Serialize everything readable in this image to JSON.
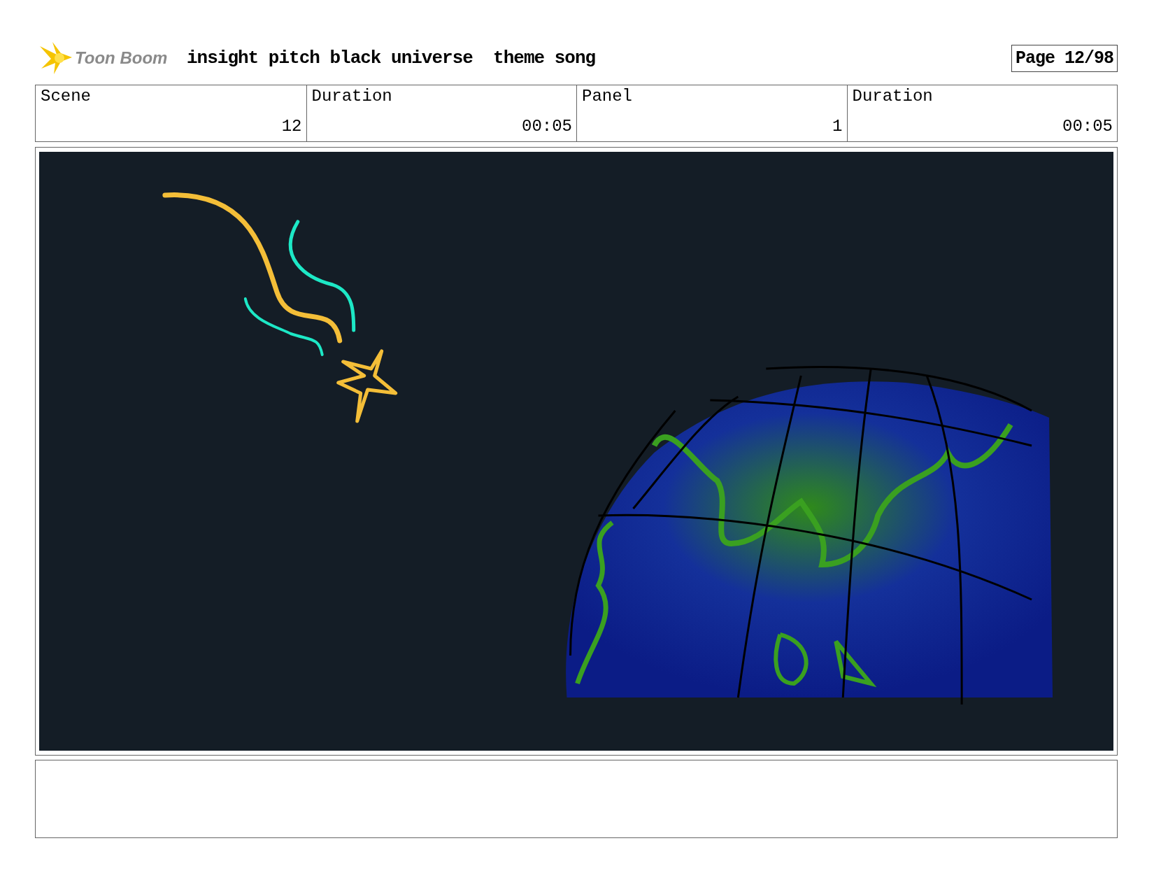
{
  "header": {
    "logo": "Toon Boom",
    "title": "insight pitch black universe  theme song",
    "page": "Page 12/98"
  },
  "info_table": {
    "columns": [
      "Scene",
      "Duration",
      "Panel",
      "Duration"
    ],
    "rows": [
      [
        "12",
        "00:05",
        "1",
        "00:05"
      ]
    ]
  }
}
